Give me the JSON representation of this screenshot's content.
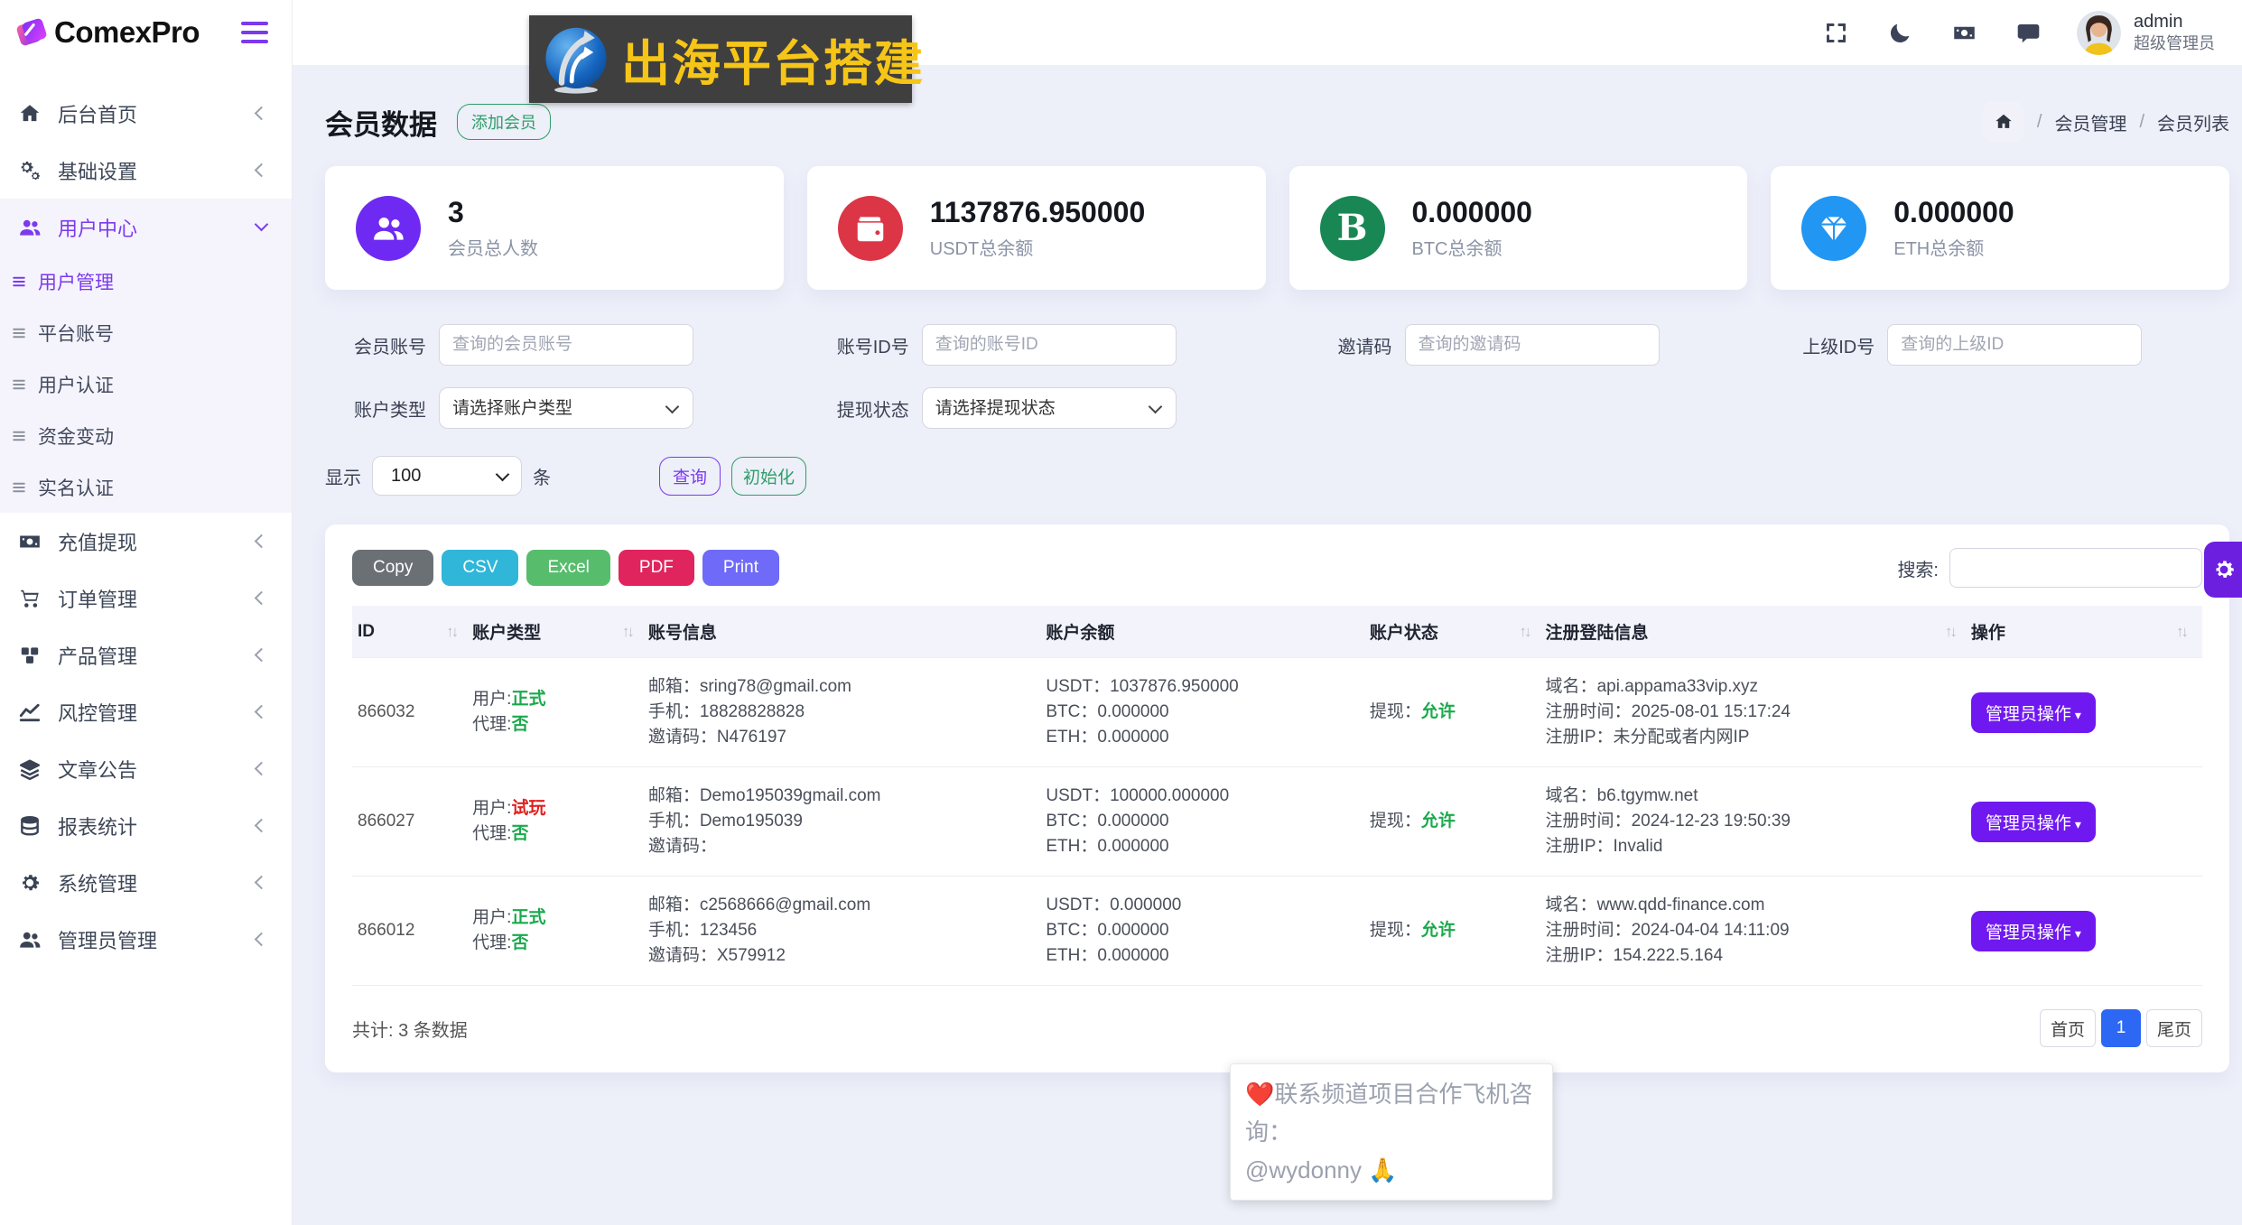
{
  "colors": {
    "accent_purple": "#7c3aed",
    "stat_member_icon": "#6e2af3",
    "stat_usdt_icon": "#dc3545",
    "stat_btc_icon": "#198754",
    "stat_eth_icon": "#2196f3",
    "btn_copy": "#6b7075",
    "btn_csv": "#2fb6d9",
    "btn_excel": "#57bd6d",
    "btn_pdf": "#e0245e",
    "btn_print": "#6f6af8",
    "btn_admin_action": "#6f19f0",
    "pagination_active": "#2d68f5",
    "status_green": "#1ba94c",
    "status_red": "#e02020",
    "banner_text_color": "#f5c518"
  },
  "sidebar": {
    "logo": "ComexPro",
    "menu": [
      {
        "label": "后台首页",
        "icon": "home-icon"
      },
      {
        "label": "基础设置",
        "icon": "gears-icon"
      },
      {
        "label": "用户中心",
        "icon": "users-icon"
      },
      {
        "label": "充值提现",
        "icon": "banknote-icon"
      },
      {
        "label": "订单管理",
        "icon": "cart-icon"
      },
      {
        "label": "产品管理",
        "icon": "cubes-icon"
      },
      {
        "label": "风控管理",
        "icon": "chart-icon"
      },
      {
        "label": "文章公告",
        "icon": "layers-icon"
      },
      {
        "label": "报表统计",
        "icon": "coins-icon"
      },
      {
        "label": "系统管理",
        "icon": "cog-icon"
      },
      {
        "label": "管理员管理",
        "icon": "admins-icon"
      }
    ],
    "submenu": [
      {
        "label": "用户管理"
      },
      {
        "label": "平台账号"
      },
      {
        "label": "用户认证"
      },
      {
        "label": "资金变动"
      },
      {
        "label": "实名认证"
      }
    ]
  },
  "topbar": {
    "user_name": "admin",
    "user_role": "超级管理员"
  },
  "banner": {
    "text": "出海平台搭建"
  },
  "page": {
    "title": "会员数据",
    "add_button": "添加会员",
    "breadcrumb": {
      "sep": "/",
      "item1": "会员管理",
      "item2": "会员列表"
    }
  },
  "stats": {
    "members": {
      "value": "3",
      "label": "会员总人数"
    },
    "usdt": {
      "value": "1137876.950000",
      "label": "USDT总余额"
    },
    "btc": {
      "value": "0.000000",
      "label": "BTC总余额",
      "icon_text": "B"
    },
    "eth": {
      "value": "0.000000",
      "label": "ETH总余额"
    }
  },
  "filters": {
    "fields": [
      {
        "label": "会员账号",
        "placeholder": "查询的会员账号"
      },
      {
        "label": "账号ID号",
        "placeholder": "查询的账号ID"
      },
      {
        "label": "邀请码",
        "placeholder": "查询的邀请码"
      },
      {
        "label": "上级ID号",
        "placeholder": "查询的上级ID"
      }
    ],
    "selects": [
      {
        "label": "账户类型",
        "value": "请选择账户类型"
      },
      {
        "label": "提现状态",
        "value": "请选择提现状态"
      }
    ],
    "show": {
      "label": "显示",
      "value": "100",
      "suffix": "条"
    },
    "query_button": "查询",
    "reset_button": "初始化"
  },
  "table": {
    "export_buttons": {
      "copy": "Copy",
      "csv": "CSV",
      "excel": "Excel",
      "pdf": "PDF",
      "print": "Print"
    },
    "search_label": "搜索:",
    "sort_glyph": "↑↓",
    "headers": [
      "ID",
      "账户类型",
      "账号信息",
      "账户余额",
      "账户状态",
      "注册登陆信息",
      "操作"
    ],
    "labels": {
      "user": "用户:",
      "agent": "代理:",
      "email": "邮箱：",
      "phone": "手机：",
      "invite": "邀请码：",
      "usdt": "USDT：",
      "btc": "BTC：",
      "eth": "ETH：",
      "withdraw": "提现：",
      "domain": "域名：",
      "reg_time": "注册时间：",
      "reg_ip": "注册IP："
    },
    "action_button": "管理员操作",
    "action_caret": "▾",
    "rows": [
      {
        "id": "866032",
        "user_type": "正式",
        "agent": "否",
        "email": "sring78@gmail.com",
        "phone": "18828828828",
        "invite": "N476197",
        "usdt": "1037876.950000",
        "btc": "0.000000",
        "eth": "0.000000",
        "withdraw": "允许",
        "domain": "api.appama33vip.xyz",
        "reg_time": "2025-08-01 15:17:24",
        "reg_ip": "未分配或者内网IP"
      },
      {
        "id": "866027",
        "user_type": "试玩",
        "agent": "否",
        "email": "Demo195039gmail.com",
        "phone": "Demo195039",
        "invite": "",
        "usdt": "100000.000000",
        "btc": "0.000000",
        "eth": "0.000000",
        "withdraw": "允许",
        "domain": "b6.tgymw.net",
        "reg_time": "2024-12-23 19:50:39",
        "reg_ip": "Invalid"
      },
      {
        "id": "866012",
        "user_type": "正式",
        "agent": "否",
        "email": "c2568666@gmail.com",
        "phone": "123456",
        "invite": "X579912",
        "usdt": "0.000000",
        "btc": "0.000000",
        "eth": "0.000000",
        "withdraw": "允许",
        "domain": "www.qdd-finance.com",
        "reg_time": "2024-04-04 14:11:09",
        "reg_ip": "154.222.5.164"
      }
    ],
    "total": "共计: 3 条数据",
    "pagination": {
      "first": "首页",
      "current": "1",
      "last": "尾页"
    }
  },
  "footer_note": {
    "heart": "❤️",
    "line1": "联系频道项目合作飞机咨询：",
    "line2": "@wydonny",
    "hands": "🙏"
  }
}
